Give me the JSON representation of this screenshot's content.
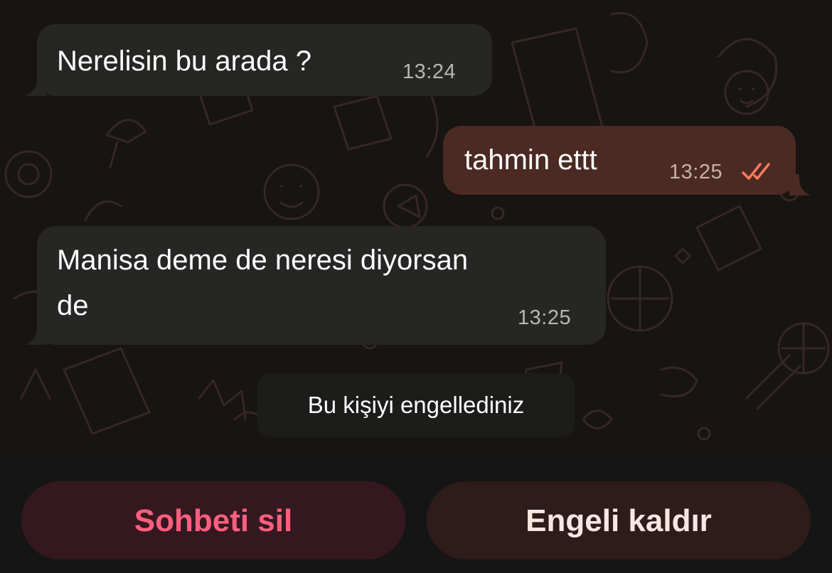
{
  "messages": [
    {
      "direction": "incoming",
      "text": "Nerelisin bu arada ?",
      "time": "13:24"
    },
    {
      "direction": "outgoing",
      "text": "tahmin ettt",
      "time": "13:25",
      "status": "read-checkmarks-icon"
    },
    {
      "direction": "incoming",
      "text": "Manisa deme de neresi diyorsan\nde",
      "time": "13:25"
    }
  ],
  "system_notice": "Bu kişiyi engellediniz",
  "actions": {
    "delete_label": "Sohbeti sil",
    "unblock_label": "Engeli kaldır"
  },
  "colors": {
    "incoming_bubble": "#262624",
    "outgoing_bubble": "#4a2a22",
    "delete_text": "#ff5f7f",
    "read_check": "#ff7a5c"
  }
}
